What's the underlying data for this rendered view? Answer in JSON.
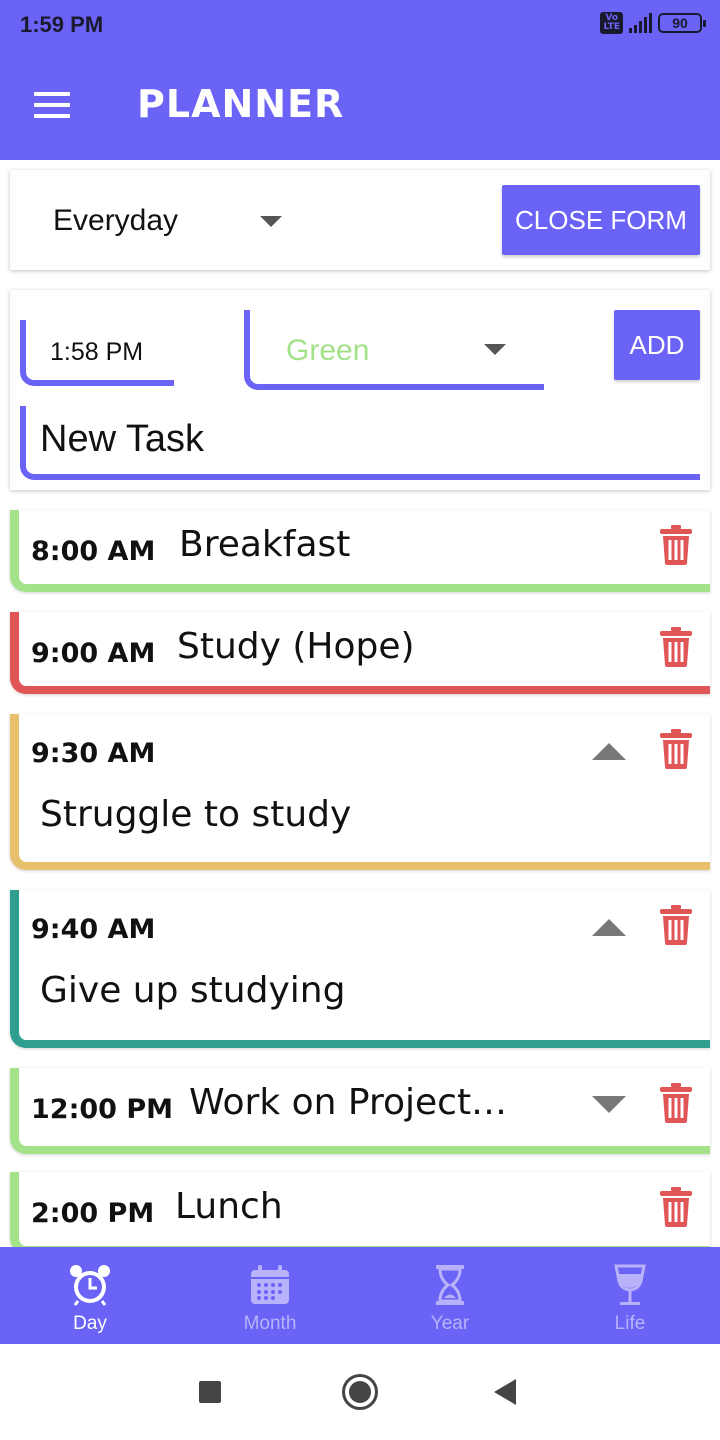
{
  "status_bar": {
    "time": "1:59 PM",
    "network": "Vo LTE",
    "battery": "90"
  },
  "header": {
    "title": "PLANNER"
  },
  "filter": {
    "frequency": "Everyday",
    "close_label": "CLOSE FORM"
  },
  "form": {
    "time": "1:58 PM",
    "color": "Green",
    "add_label": "ADD",
    "task_text": "New Task"
  },
  "tasks": [
    {
      "time": "8:00 AM",
      "title": "Breakfast",
      "color": "#a4e28a"
    },
    {
      "time": "9:00 AM",
      "title": "Study (Hope)",
      "color": "#e05555"
    },
    {
      "time": "9:30 AM",
      "title": "Struggle to study",
      "color": "#e6c06a",
      "expander": "up"
    },
    {
      "time": "9:40 AM",
      "title": "Give up studying",
      "color": "#2f9e8f",
      "expander": "up"
    },
    {
      "time": "12:00 PM",
      "title": "Work on Project…",
      "color": "#a4e28a",
      "expander": "down"
    },
    {
      "time": "2:00 PM",
      "title": "Lunch",
      "color": "#a4e28a"
    }
  ],
  "bottom_nav": [
    {
      "label": "Day",
      "icon": "alarm-clock-icon",
      "active": true
    },
    {
      "label": "Month",
      "icon": "calendar-icon",
      "active": false
    },
    {
      "label": "Year",
      "icon": "hourglass-icon",
      "active": false
    },
    {
      "label": "Life",
      "icon": "wine-glass-icon",
      "active": false
    }
  ],
  "colors": {
    "primary": "#6b63f5",
    "delete": "#e05555",
    "inactive_nav": "#b8b2fb"
  }
}
